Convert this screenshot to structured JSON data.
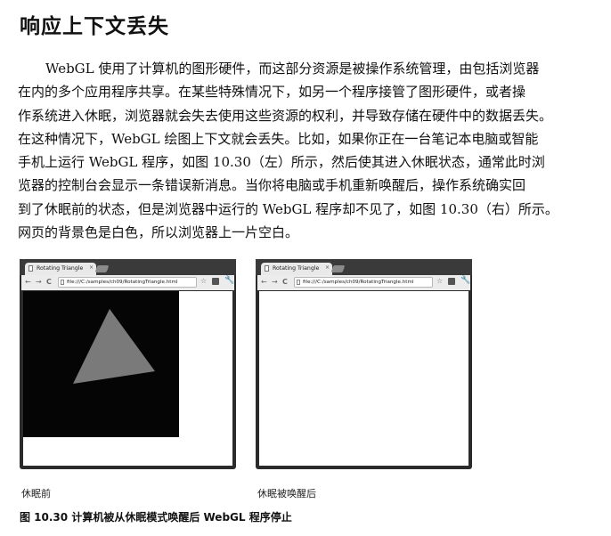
{
  "heading": "响应上下文丢失",
  "paragraph_lines": [
    "WebGL 使用了计算机的图形硬件，而这部分资源是被操作系统管理，由包括浏览器",
    "在内的多个应用程序共享。在某些特殊情况下，如另一个程序接管了图形硬件，或者操",
    "作系统进入休眠，浏览器就会失去使用这些资源的权利，并导致存储在硬件中的数据丢失。",
    "在这种情况下，WebGL 绘图上下文就会丢失。比如，如果你正在一台笔记本电脑或智能",
    "手机上运行 WebGL 程序，如图 10.30（左）所示，然后使其进入休眠状态，通常此时浏",
    "览器的控制台会显示一条错误新消息。当你将电脑或手机重新唤醒后，操作系统确实回",
    "到了休眠前的状态，但是浏览器中运行的 WebGL 程序却不见了，如图 10.30（右）所示。",
    "网页的背景色是白色，所以浏览器上一片空白。"
  ],
  "figures": {
    "left": {
      "tab_title": "Rotating Triangle",
      "close_glyph": "×",
      "back_glyph": "←",
      "forward_glyph": "→",
      "reload_glyph": "C",
      "url": "file:///C:/samples/ch09/RotatingTriangle.html",
      "star_glyph": "☆",
      "wrench_glyph": "🔧",
      "caption": "休眠前",
      "canvas_bg": "#050505",
      "triangle_color": "#7a7a7a"
    },
    "right": {
      "tab_title": "Rotating Triangle",
      "close_glyph": "×",
      "back_glyph": "←",
      "forward_glyph": "→",
      "reload_glyph": "C",
      "url": "file:///C:/samples/ch09/RotatingTriangle.html",
      "star_glyph": "☆",
      "wrench_glyph": "🔧",
      "caption": "休眠被唤醒后",
      "page_bg": "#ffffff"
    }
  },
  "figure_caption": "图 10.30 计算机被从休眠模式唤醒后 WebGL 程序停止"
}
